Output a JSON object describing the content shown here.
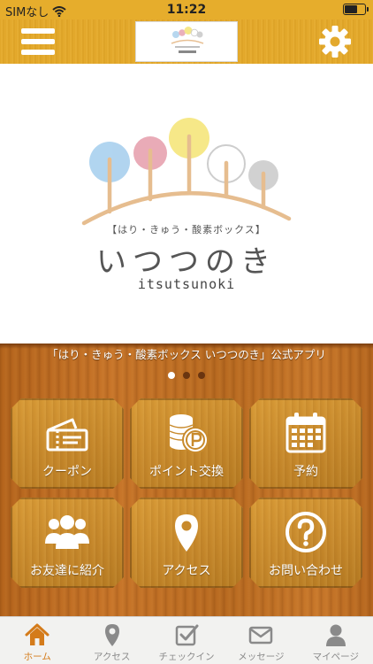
{
  "status_bar": {
    "carrier": "SIMなし",
    "time": "11:22"
  },
  "brand": {
    "subtitle": "【はり・きゅう・酸素ボックス】",
    "name": "いつつのき",
    "romanized": "itsutsunoki"
  },
  "tagline": "「はり・きゅう・酸素ボックス いつつのき」公式アプリ",
  "carousel": {
    "count": 3,
    "active_index": 0
  },
  "tiles": [
    {
      "label": "クーポン",
      "icon": "ticket-icon"
    },
    {
      "label": "ポイント交換",
      "icon": "coins-icon"
    },
    {
      "label": "予約",
      "icon": "calendar-icon"
    },
    {
      "label": "お友達に紹介",
      "icon": "friends-icon"
    },
    {
      "label": "アクセス",
      "icon": "map-pin-icon"
    },
    {
      "label": "お問い合わせ",
      "icon": "question-icon"
    }
  ],
  "tabbar": [
    {
      "label": "ホーム",
      "icon": "home-icon",
      "active": true
    },
    {
      "label": "アクセス",
      "icon": "map-pin-icon",
      "active": false
    },
    {
      "label": "チェックイン",
      "icon": "check-in-icon",
      "active": false
    },
    {
      "label": "メッセージ",
      "icon": "mail-icon",
      "active": false
    },
    {
      "label": "マイページ",
      "icon": "person-icon",
      "active": false
    }
  ],
  "colors": {
    "header": "#e6ad2c",
    "wood": "#c07027",
    "tab_active": "#d47b1a",
    "tab_inactive": "#8a8a8a",
    "logo_line": "#e8c094"
  }
}
